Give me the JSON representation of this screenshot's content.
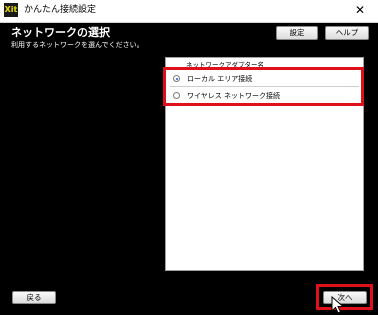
{
  "window": {
    "app_icon_text": "Xit",
    "title": "かんたん接続設定",
    "close_glyph": "✕"
  },
  "page": {
    "heading": "ネットワークの選択",
    "subheading": "利用するネットワークを選んでください。"
  },
  "toolbar": {
    "settings_label": "設定",
    "help_label": "ヘルプ"
  },
  "adapter_list": {
    "header": "ネットワークアダプター名",
    "items": [
      {
        "label": "ローカル エリア接続",
        "selected": true
      },
      {
        "label": "ワイヤレス ネットワーク接続",
        "selected": false
      }
    ]
  },
  "footer": {
    "back_label": "戻る",
    "next_label": "次へ"
  },
  "colors": {
    "highlight": "#e0101a",
    "background": "#000000"
  }
}
